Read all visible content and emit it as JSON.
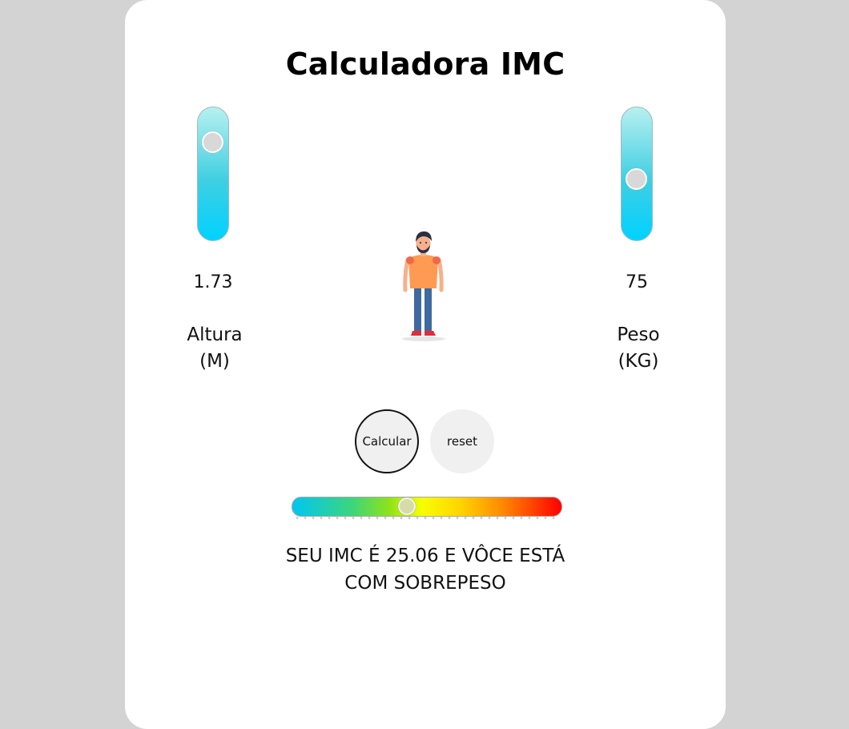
{
  "app": {
    "title": "Calculadora IMC"
  },
  "height": {
    "value": "1.73",
    "label_line1": "Altura",
    "label_line2": "(M)",
    "level": 0.8
  },
  "weight": {
    "value": "75",
    "label_line1": "Peso",
    "label_line2": "(KG)",
    "level": 0.45
  },
  "buttons": {
    "calculate": "Calcular",
    "reset": "reset"
  },
  "scale": {
    "position": 0.42
  },
  "result": {
    "line1": "SEU IMC É 25.06 E VÔCE ESTÁ",
    "line2": "COM SOBREPESO"
  },
  "colors": {
    "page_bg": "#d3d3d3",
    "card_bg": "#ffffff",
    "slider_fill": "#00d2ff"
  }
}
